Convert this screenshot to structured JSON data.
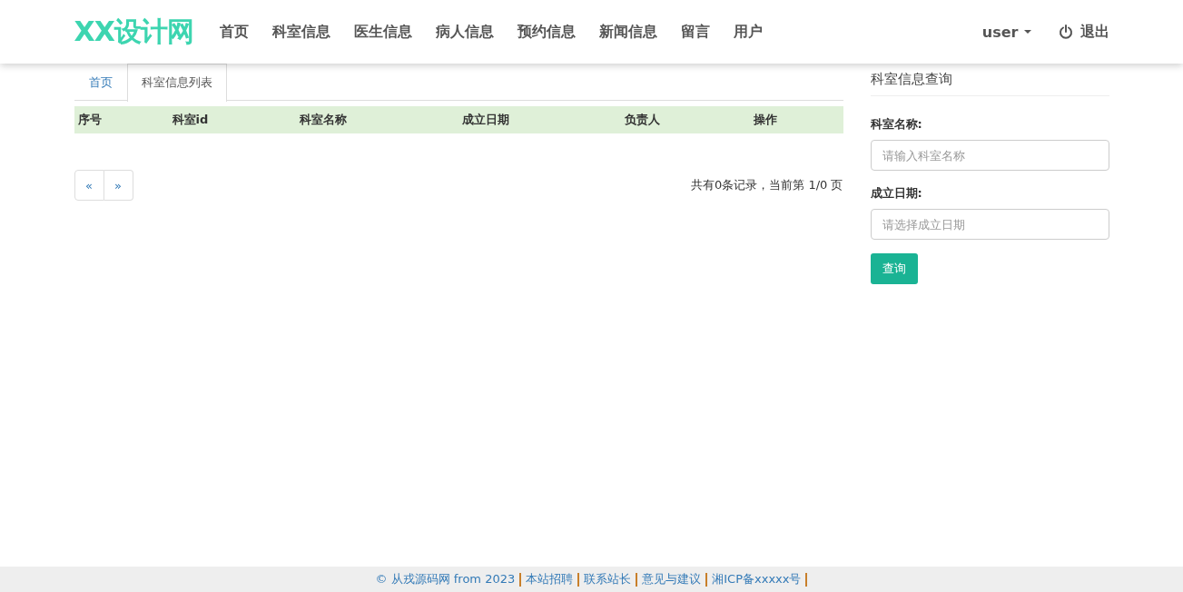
{
  "navbar": {
    "brand": "XX设计网",
    "items": [
      {
        "label": "首页"
      },
      {
        "label": "科室信息"
      },
      {
        "label": "医生信息"
      },
      {
        "label": "病人信息"
      },
      {
        "label": "预约信息"
      },
      {
        "label": "新闻信息"
      },
      {
        "label": "留言"
      },
      {
        "label": "用户"
      }
    ],
    "user_menu": "user",
    "logout": "退出"
  },
  "tabs": [
    {
      "label": "首页",
      "selected": false
    },
    {
      "label": "科室信息列表",
      "selected": true
    }
  ],
  "table": {
    "columns": [
      "序号",
      "科室id",
      "科室名称",
      "成立日期",
      "负责人",
      "操作"
    ]
  },
  "pagination": {
    "prev": "«",
    "next": "»",
    "summary": "共有0条记录，当前第 1/0 页"
  },
  "sidebar": {
    "title": "科室信息查询",
    "fields": [
      {
        "label": "科室名称:",
        "placeholder": "请输入科室名称"
      },
      {
        "label": "成立日期:",
        "placeholder": "请选择成立日期"
      }
    ],
    "button": "查询"
  },
  "footer": {
    "links": [
      "© 从戎源码网 from 2023",
      "本站招聘",
      "联系站长",
      "意见与建议",
      "湘ICP备xxxxx号"
    ]
  }
}
